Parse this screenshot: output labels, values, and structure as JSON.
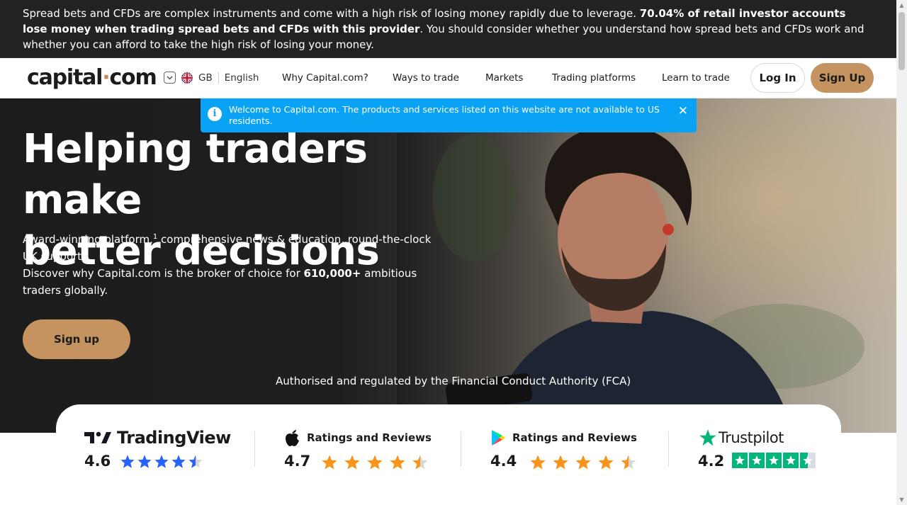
{
  "risk_banner": {
    "text_1": "Spread bets and CFDs are complex instruments and come with a high risk of losing money rapidly due to leverage. ",
    "text_bold": "70.04% of retail investor accounts lose money when trading spread bets and CFDs with this provider",
    "text_2": ". You should consider whether you understand how spread bets and CFDs work and whether you can afford to take the high risk of losing your money."
  },
  "header": {
    "logo_part1": "capital",
    "logo_dot": "·",
    "logo_part2": "com",
    "country": "GB",
    "language": "English",
    "nav": [
      "Why Capital.com?",
      "Ways to trade",
      "Markets",
      "Trading platforms",
      "Learn to trade"
    ],
    "login_label": "Log In",
    "signup_label": "Sign Up"
  },
  "alert": {
    "message": "Welcome to Capital.com. The products and services listed on this website are not available to US residents.",
    "close_symbol": "✕",
    "info_symbol": "i"
  },
  "hero": {
    "title_line1": "Helping traders make",
    "title_line2": "better decisions",
    "sub_1": "Award-winning platform,",
    "sub_sup": "1",
    "sub_2": " comprehensive news & education, round-the-clock UK support.",
    "sub_3": "Discover why Capital.com is the broker of choice for ",
    "sub_bold": "610,000+",
    "sub_4": " ambitious traders globally.",
    "cta_label": "Sign up",
    "regulation": "Authorised and regulated by the Financial Conduct Authority (FCA)"
  },
  "ratings": [
    {
      "source": "TradingView",
      "score": "4.6",
      "value": 4.6,
      "star_color": "#2962ff"
    },
    {
      "source": "Ratings and Reviews",
      "score": "4.7",
      "value": 4.7,
      "star_color": "#f7941d"
    },
    {
      "source": "Ratings and Reviews",
      "score": "4.4",
      "value": 4.4,
      "star_color": "#f7941d"
    },
    {
      "source": "Trustpilot",
      "score": "4.2",
      "value": 4.2,
      "star_color": "#00b67a"
    }
  ],
  "colors": {
    "accent": "#c4935f",
    "alert_bg": "#0aa2f5",
    "dark_bg": "#222222"
  }
}
